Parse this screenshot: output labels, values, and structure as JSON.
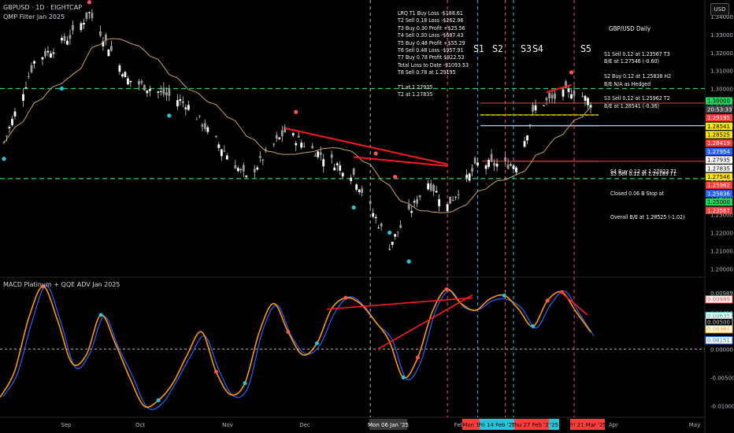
{
  "header": {
    "symbol_line": "GBPUSD · 1D · EIGHTCAP",
    "indicator_line": "QMP Filter Jan 2025"
  },
  "currency_button": "USD",
  "macd_title": "MACD Platinum + QQE ADV Jan 2025",
  "trade_log": [
    "LRQ T1 Buy Loss -$188.61",
    "T2 Sell 0.18 Loss -$262.96",
    "T3 Buy 0.30 Profit +$25.56",
    "T4 Sell 0.30 Loss -$687.43",
    "T5 Buy 0.48 Profit +$55.29",
    "T6 Sell 0.48 Loss -$957.91",
    "T7 Buy 0.78 Profit $922.53",
    "Total Loss to Date -$1093.53",
    "T8 Sell 0.78 at 1.29195",
    "",
    "T1 at 1.27935",
    "T2 at 1.27835"
  ],
  "daily_notes": {
    "title": "GBP/USD Daily",
    "lines": [
      "S1 Sell 0.12 at 1.23567 T3",
      "B/E at 1.27546 (-0.60)",
      "",
      "S2 Buy 0.12 at 1.25838 H2",
      "B/E N/A as Hedged",
      "",
      "S3 Sell 0.12 at 1.25962 T2",
      "B/E at 1.28541 (-0.36)"
    ]
  },
  "s4_note": [
    "S4 Buy 0.12 at 1.27923 T1",
    "Closed 0.06 B Stop at"
  ],
  "s5_note": "S5 Sell 0.12 at 1.29189 T1",
  "overall_note": "Overall B/E at 1.28525 (-1.02)",
  "colors": {
    "background": "#000000",
    "up_candle": "#ffffff",
    "down_candle": "#ffffff",
    "ma_line": "#c8a165",
    "macd_line": "#ff9800",
    "signal_line": "#2962ff",
    "trend_line": "#ff1a1a",
    "green_dash": "#1ed760",
    "yellow_line": "#ffe600",
    "red_level": "#ff3b3b",
    "teal_dot": "#26c6da",
    "red_dot": "#ff5252",
    "vertical_dash_red": "#ff5252",
    "vertical_dash_blue": "#29b6f6",
    "vertical_dash_white": "#bdbdbd"
  },
  "chart_data": [
    {
      "type": "candlestick",
      "title": "GBPUSD · 1D · EIGHTCAP",
      "y_axis_ticks": [
        "1.34000",
        "1.33000",
        "1.32000",
        "1.31000",
        "1.30000",
        "1.29000",
        "1.28000",
        "1.27000",
        "1.26000",
        "1.25000",
        "1.24000",
        "1.23000",
        "1.22000",
        "1.21000",
        "1.20000"
      ],
      "ylim": [
        1.1953,
        1.3492
      ],
      "x_axis_ticks": [
        "Sep",
        "Oct",
        "Nov",
        "Dec",
        "Mon 06 Jan '25",
        "Feb",
        "Mon 1",
        "Fri 14 Feb '25",
        "Thu 27 Feb '25",
        "'25",
        "Fri 21 Mar '25",
        "Apr",
        "May"
      ],
      "close_path_approx": [
        {
          "date": "2024-08-26",
          "close": 1.27
        },
        {
          "date": "2024-09-06",
          "close": 1.315
        },
        {
          "date": "2024-09-20",
          "close": 1.33
        },
        {
          "date": "2024-09-26",
          "close": 1.342
        },
        {
          "date": "2024-10-10",
          "close": 1.305
        },
        {
          "date": "2024-10-31",
          "close": 1.292
        },
        {
          "date": "2024-11-22",
          "close": 1.25
        },
        {
          "date": "2024-12-06",
          "close": 1.276
        },
        {
          "date": "2024-12-31",
          "close": 1.252
        },
        {
          "date": "2025-01-13",
          "close": 1.213
        },
        {
          "date": "2025-01-27",
          "close": 1.248
        },
        {
          "date": "2025-02-03",
          "close": 1.235
        },
        {
          "date": "2025-02-14",
          "close": 1.258
        },
        {
          "date": "2025-02-28",
          "close": 1.258
        },
        {
          "date": "2025-03-07",
          "close": 1.29
        },
        {
          "date": "2025-03-20",
          "close": 1.299
        },
        {
          "date": "2025-03-27",
          "close": 1.293
        }
      ],
      "price_labels": [
        {
          "label": "1.30000",
          "color": "#1ed760"
        },
        {
          "label": "20:53:33",
          "color": "#424242"
        },
        {
          "label": "1.29195",
          "color": "#ff3b3b"
        },
        {
          "label": "1.28541",
          "color": "#ffe600"
        },
        {
          "label": "1.28525",
          "color": "#ffe600"
        },
        {
          "label": "1.28419",
          "color": "#ff3b3b"
        },
        {
          "label": "1.27954",
          "color": "#2962ff"
        },
        {
          "label": "1.27935",
          "color": "#ffffff"
        },
        {
          "label": "1.27835",
          "color": "#ffffff"
        },
        {
          "label": "1.27546",
          "color": "#ffe600"
        },
        {
          "label": "1.25962",
          "color": "#ff3b3b"
        },
        {
          "label": "1.25836",
          "color": "#2962ff"
        },
        {
          "label": "1.25000",
          "color": "#1ed760"
        },
        {
          "label": "1.23567",
          "color": "#ff3b3b"
        }
      ],
      "horizontal_levels": [
        {
          "value": 1.3,
          "style": "green-dash"
        },
        {
          "value": 1.29195,
          "style": "red"
        },
        {
          "value": 1.28541,
          "style": "yellow"
        },
        {
          "value": 1.28525,
          "style": "yellow-dash"
        },
        {
          "value": 1.27954,
          "style": "blue"
        },
        {
          "value": 1.27935,
          "style": "white"
        },
        {
          "value": 1.25,
          "style": "green-dash"
        },
        {
          "value": 1.25962,
          "style": "red"
        }
      ],
      "signal_markers": [
        "S1",
        "S2",
        "S3",
        "S4",
        "S5"
      ]
    },
    {
      "type": "line",
      "title": "MACD Platinum + QQE ADV Jan 2025",
      "y_axis_ticks": [
        "0.00989",
        "0.00635",
        "0.00500",
        "0.00361",
        "0.00151",
        "0.00000",
        "-0.00500",
        "-0.01000"
      ],
      "ylim": [
        -0.0113,
        0.0125
      ],
      "series": [
        {
          "values_approx": [
            -0.0085,
            -0.004,
            0.0055,
            0.011,
            0.005,
            -0.0025,
            -0.001,
            0.006,
            0.001,
            -0.005,
            -0.01,
            -0.009,
            -0.006,
            -0.001,
            0.003,
            -0.004,
            -0.008,
            -0.006,
            0.003,
            0.008,
            0.003,
            -0.001,
            0.001,
            0.007,
            0.009,
            0.008,
            0.005,
            0.0015,
            -0.005,
            -0.0015,
            0.0065,
            0.0105,
            0.008,
            0.0068,
            0.0088,
            0.0094,
            0.007,
            0.004,
            0.0085,
            0.01,
            0.0065,
            0.003
          ]
        }
      ],
      "current_values": [
        "0.00989",
        "0.00635",
        "0.00500",
        "0.00361",
        "0.00151"
      ]
    }
  ]
}
